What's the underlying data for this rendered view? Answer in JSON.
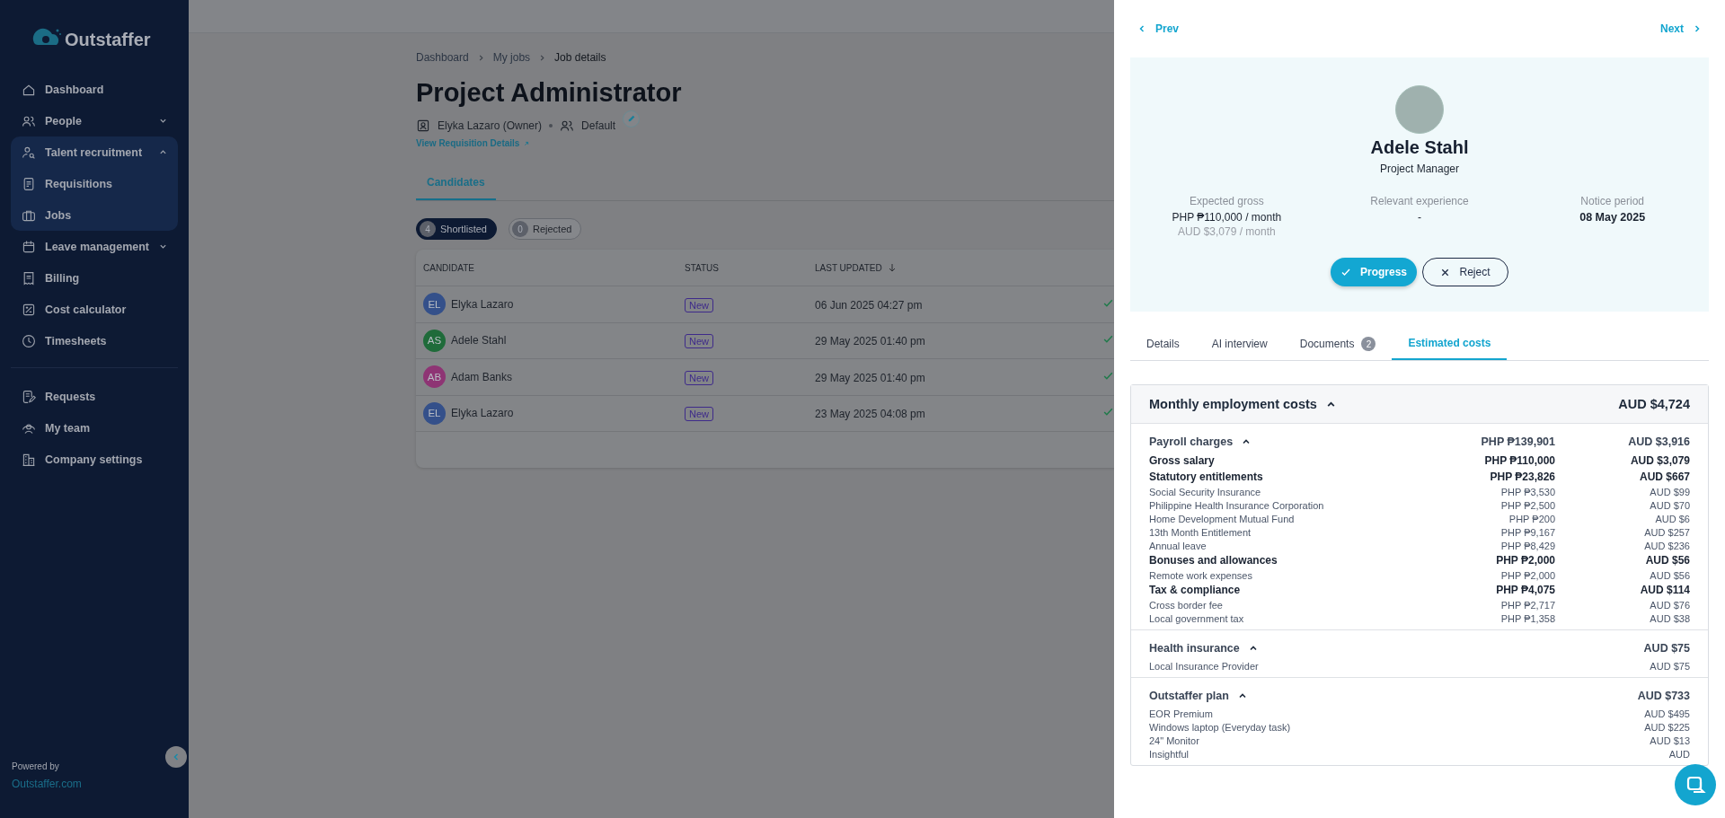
{
  "logo": {
    "text": "Outstaffer"
  },
  "sidebar": {
    "sections": [
      {
        "items": [
          {
            "label": "Dashboard"
          },
          {
            "label": "People",
            "expanded": false
          },
          {
            "label": "Talent recruitment",
            "expanded": true,
            "children": [
              {
                "label": "Requisitions"
              },
              {
                "label": "Jobs"
              }
            ]
          },
          {
            "label": "Leave management",
            "expanded": false
          },
          {
            "label": "Billing"
          },
          {
            "label": "Cost calculator"
          },
          {
            "label": "Timesheets"
          }
        ]
      },
      {
        "items": [
          {
            "label": "Requests"
          },
          {
            "label": "My team"
          },
          {
            "label": "Company settings"
          }
        ]
      }
    ],
    "footer": {
      "powered_by": "Powered by",
      "link": "Outstaffer.com"
    }
  },
  "breadcrumbs": [
    "Dashboard",
    "My jobs",
    "Job details"
  ],
  "job": {
    "title": "Project Administrator",
    "owner": "Elyka Lazaro (Owner)",
    "team": "Default",
    "link": "View Requisition Details"
  },
  "tabs": [
    {
      "label": "Candidates",
      "selected": true
    }
  ],
  "filters": [
    {
      "count": "4",
      "label": "Shortlisted",
      "selected": true
    },
    {
      "count": "0",
      "label": "Rejected",
      "selected": false
    }
  ],
  "table": {
    "columns": [
      "CANDIDATE",
      "STATUS",
      "LAST UPDATED"
    ],
    "rows": [
      {
        "initials": "EL",
        "color": "#34508a",
        "name": "Elyka Lazaro",
        "status": "New",
        "updated": "06 Jun 2025 04:27 pm"
      },
      {
        "initials": "AS",
        "color": "#1f6b3a",
        "name": "Adele Stahl",
        "status": "New",
        "updated": "29 May 2025 01:40 pm"
      },
      {
        "initials": "AB",
        "color": "#8e3474",
        "name": "Adam Banks",
        "status": "New",
        "updated": "29 May 2025 01:40 pm"
      },
      {
        "initials": "EL",
        "color": "#34508a",
        "name": "Elyka Lazaro",
        "status": "New",
        "updated": "23 May 2025 04:08 pm"
      }
    ]
  },
  "drawer": {
    "prev": "Prev",
    "next": "Next",
    "profile": {
      "name": "Adele Stahl",
      "role": "Project Manager",
      "stats": [
        {
          "label": "Expected gross",
          "value": "PHP ₱110,000 / month",
          "secondary": "AUD $3,079 / month"
        },
        {
          "label": "Relevant experience",
          "value": "-"
        },
        {
          "label": "Notice period",
          "value": "08 May 2025"
        }
      ],
      "actions": [
        {
          "kind": "progress",
          "label": "Progress"
        },
        {
          "kind": "reject",
          "label": "Reject"
        }
      ]
    },
    "tabs": [
      {
        "label": "Details",
        "selected": false
      },
      {
        "label": "AI interview",
        "selected": false
      },
      {
        "label": "Documents",
        "badge": "2",
        "selected": false
      },
      {
        "label": "Estimated costs",
        "selected": true
      }
    ],
    "costs": {
      "title": "Monthly employment costs",
      "total": "AUD $4,724",
      "expanded": true,
      "sections": [
        {
          "title": "Payroll charges",
          "expanded": true,
          "php": "PHP ₱139,901",
          "aud": "AUD $3,916",
          "rows": [
            {
              "kind": "group",
              "label": "Gross salary",
              "php": "PHP ₱110,000",
              "aud": "AUD $3,079"
            },
            {
              "kind": "group",
              "label": "Statutory entitlements",
              "php": "PHP ₱23,826",
              "aud": "AUD $667"
            },
            {
              "kind": "item",
              "label": "Social Security Insurance",
              "php": "PHP ₱3,530",
              "aud": "AUD $99"
            },
            {
              "kind": "item",
              "label": "Philippine Health Insurance Corporation",
              "php": "PHP ₱2,500",
              "aud": "AUD $70"
            },
            {
              "kind": "item",
              "label": "Home Development Mutual Fund",
              "php": "PHP ₱200",
              "aud": "AUD $6"
            },
            {
              "kind": "item",
              "label": "13th Month Entitlement",
              "php": "PHP ₱9,167",
              "aud": "AUD $257"
            },
            {
              "kind": "item",
              "label": "Annual leave",
              "php": "PHP ₱8,429",
              "aud": "AUD $236"
            },
            {
              "kind": "group",
              "label": "Bonuses and allowances",
              "php": "PHP ₱2,000",
              "aud": "AUD $56"
            },
            {
              "kind": "item",
              "label": "Remote work expenses",
              "php": "PHP ₱2,000",
              "aud": "AUD $56"
            },
            {
              "kind": "group",
              "label": "Tax & compliance",
              "php": "PHP ₱4,075",
              "aud": "AUD $114"
            },
            {
              "kind": "item",
              "label": "Cross border fee",
              "php": "PHP ₱2,717",
              "aud": "AUD $76"
            },
            {
              "kind": "item",
              "label": "Local government tax",
              "php": "PHP ₱1,358",
              "aud": "AUD $38"
            }
          ]
        },
        {
          "title": "Health insurance",
          "expanded": true,
          "aud": "AUD $75",
          "rows": [
            {
              "kind": "item",
              "label": "Local Insurance Provider",
              "aud": "AUD $75"
            }
          ]
        },
        {
          "title": "Outstaffer plan",
          "expanded": true,
          "aud": "AUD $733",
          "rows": [
            {
              "kind": "item",
              "label": "EOR Premium",
              "aud": "AUD $495"
            },
            {
              "kind": "item",
              "label": "Windows laptop (Everyday task)",
              "aud": "AUD $225"
            },
            {
              "kind": "item",
              "label": "24\" Monitor",
              "aud": "AUD $13"
            },
            {
              "kind": "item",
              "label": "Insightful",
              "aud": "AUD"
            }
          ]
        }
      ]
    }
  }
}
